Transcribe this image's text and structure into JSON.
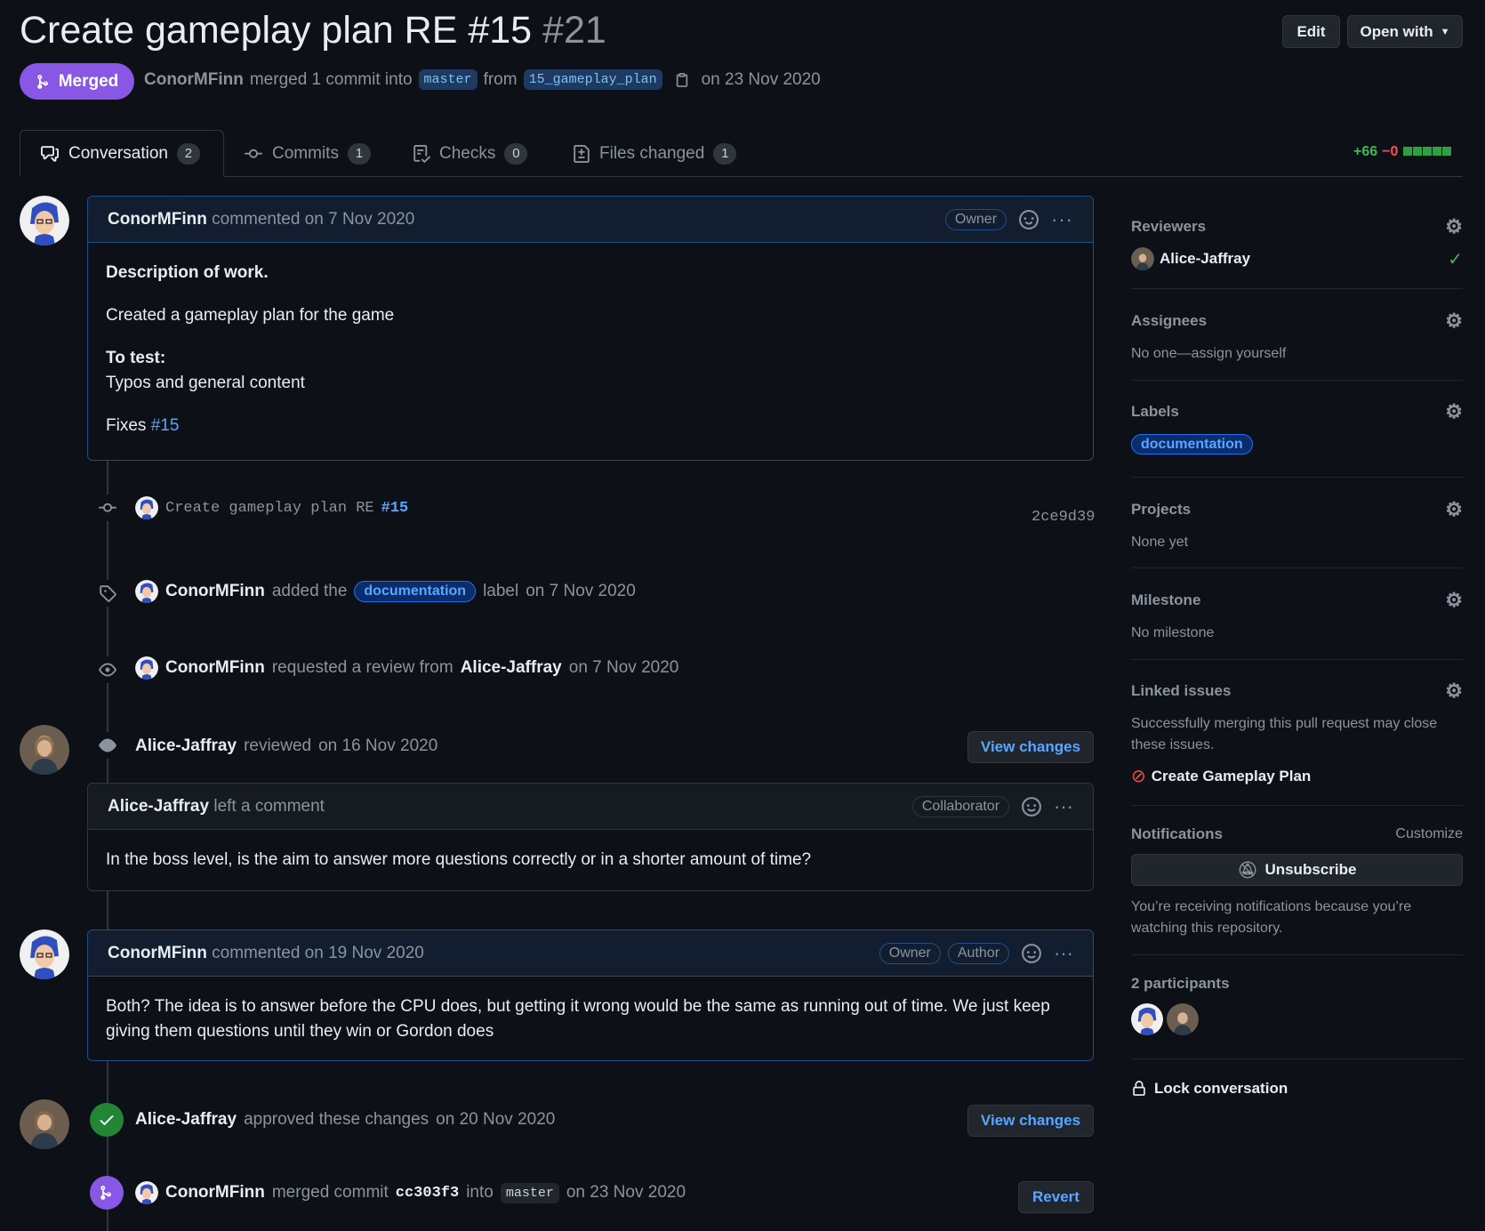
{
  "header": {
    "title": "Create gameplay plan RE #15",
    "number": "#21",
    "edit_label": "Edit",
    "open_with_label": "Open with",
    "state": "Merged",
    "author": "ConorMFinn",
    "merge_text": "merged 1 commit into",
    "base_branch": "master",
    "from_text": "from",
    "head_branch": "15_gameplay_plan",
    "merge_date": "on 23 Nov 2020"
  },
  "tabs": [
    {
      "label": "Conversation",
      "count": "2"
    },
    {
      "label": "Commits",
      "count": "1"
    },
    {
      "label": "Checks",
      "count": "0"
    },
    {
      "label": "Files changed",
      "count": "1"
    }
  ],
  "diffstat": {
    "additions": "+66",
    "deletions": "−0"
  },
  "timeline": {
    "first_comment": {
      "author": "ConorMFinn",
      "date": "commented on 7 Nov 2020",
      "role": "Owner",
      "heading": "Description of work.",
      "desc": "Created a gameplay plan for the game",
      "test_heading": "To test:",
      "test_text": "Typos and general content",
      "fixes_text": "Fixes",
      "fixes_link": "#15"
    },
    "commit": {
      "message": "Create gameplay plan RE",
      "ref": "#15",
      "sha": "2ce9d39"
    },
    "label_event": {
      "author": "ConorMFinn",
      "text": "added the",
      "label": "documentation",
      "suffix": "label",
      "date": "on 7 Nov 2020"
    },
    "review_request": {
      "author": "ConorMFinn",
      "text": "requested a review from",
      "reviewer": "Alice-Jaffray",
      "date": "on 7 Nov 2020"
    },
    "review": {
      "author": "Alice-Jaffray",
      "text": "reviewed",
      "date": "on 16 Nov 2020",
      "button": "View changes",
      "comment_author": "Alice-Jaffray",
      "comment_text": "left a comment",
      "role": "Collaborator",
      "body": "In the boss level, is the aim to answer more questions correctly or in a shorter amount of time?"
    },
    "reply": {
      "author": "ConorMFinn",
      "date": "commented on 19 Nov 2020",
      "role1": "Owner",
      "role2": "Author",
      "body": "Both? The idea is to answer before the CPU does, but getting it wrong would be the same as running out of time. We just keep giving them questions until they win or Gordon does"
    },
    "approval": {
      "author": "Alice-Jaffray",
      "text": "approved these changes",
      "date": "on 20 Nov 2020",
      "button": "View changes"
    },
    "merged": {
      "author": "ConorMFinn",
      "text": "merged commit",
      "sha": "cc303f3",
      "into": "into",
      "branch": "master",
      "date": "on 23 Nov 2020",
      "button": "Revert"
    }
  },
  "sidebar": {
    "reviewers": {
      "title": "Reviewers",
      "name": "Alice-Jaffray"
    },
    "assignees": {
      "title": "Assignees",
      "text": "No one—assign yourself"
    },
    "labels": {
      "title": "Labels",
      "label": "documentation"
    },
    "projects": {
      "title": "Projects",
      "text": "None yet"
    },
    "milestone": {
      "title": "Milestone",
      "text": "No milestone"
    },
    "linked_issues": {
      "title": "Linked issues",
      "text": "Successfully merging this pull request may close these issues.",
      "issue": "Create Gameplay Plan"
    },
    "notifications": {
      "title": "Notifications",
      "customize": "Customize",
      "button": "Unsubscribe",
      "text": "You’re receiving notifications because you’re watching this repository."
    },
    "participants": {
      "title": "2 participants"
    },
    "lock": "Lock conversation"
  },
  "colors": {
    "merged": "#8957e5",
    "approved": "#238636",
    "link": "#58a6ff",
    "added": "#3fb950",
    "deleted": "#f85149"
  }
}
